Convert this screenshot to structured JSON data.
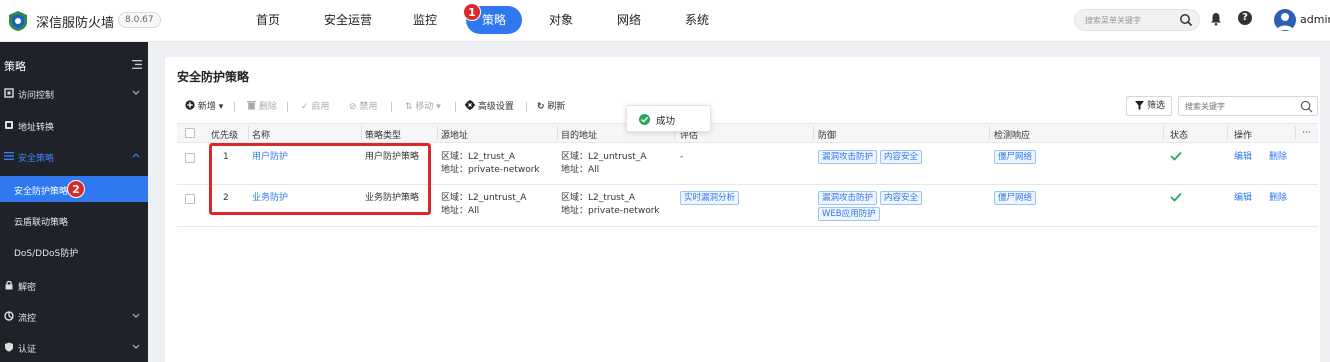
{
  "app": {
    "brand": "深信服防火墙",
    "version": "8.0.67",
    "user": "admin"
  },
  "topnav": [
    {
      "label": "首页"
    },
    {
      "label": "安全运营"
    },
    {
      "label": "监控"
    },
    {
      "label": "策略"
    },
    {
      "label": "对象"
    },
    {
      "label": "网络"
    },
    {
      "label": "系统"
    }
  ],
  "topnav_badge": "1",
  "top_search": {
    "placeholder": "搜索菜单关键字"
  },
  "sidebar": {
    "title": "策略",
    "items": [
      {
        "label": "访问控制",
        "icon": "access-control-icon"
      },
      {
        "label": "地址转换",
        "icon": "address-translation-icon"
      },
      {
        "label": "安全策略",
        "icon": "list-icon"
      },
      {
        "label": "解密",
        "icon": "lock-icon"
      },
      {
        "label": "流控",
        "icon": "flow-control-icon"
      },
      {
        "label": "认证",
        "icon": "shield-icon"
      }
    ],
    "sub_items": [
      {
        "label": "安全防护策略"
      },
      {
        "label": "云盾联动策略"
      },
      {
        "label": "DoS/DDoS防护"
      }
    ],
    "sub_badge": "2"
  },
  "panel": {
    "title": "安全防护策略",
    "toolbar": {
      "new": "新增",
      "delete": "删除",
      "enable": "启用",
      "disable": "禁用",
      "move": "移动",
      "advanced": "高级设置",
      "refresh": "刷新"
    },
    "filter": "筛选",
    "search_placeholder": "搜索关键字"
  },
  "table": {
    "headers": [
      "优先级",
      "名称",
      "策略类型",
      "源地址",
      "目的地址",
      "评估",
      "防御",
      "检测响应",
      "状态",
      "操作",
      "···"
    ],
    "rows": [
      {
        "priority": "1",
        "name": "用户防护",
        "type": "用户防护策略",
        "src_zone": "区域：L2_trust_A",
        "src_addr": "地址：private-network",
        "dst_zone": "区域：L2_untrust_A",
        "dst_addr": "地址：All",
        "eval": "-",
        "eval_tags": [],
        "defense_tags": [
          "漏洞攻击防护",
          "内容安全"
        ],
        "detect_tags": [
          "僵尸网络"
        ],
        "status": "enabled",
        "edit": "编辑",
        "delete": "删除"
      },
      {
        "priority": "2",
        "name": "业务防护",
        "type": "业务防护策略",
        "src_zone": "区域：L2_untrust_A",
        "src_addr": "地址：All",
        "dst_zone": "区域：L2_trust_A",
        "dst_addr": "地址：private-network",
        "eval": "",
        "eval_tags": [
          "实时漏洞分析"
        ],
        "defense_tags": [
          "漏洞攻击防护",
          "内容安全",
          "WEB应用防护"
        ],
        "detect_tags": [
          "僵尸网络"
        ],
        "status": "enabled",
        "edit": "编辑",
        "delete": "删除"
      }
    ]
  },
  "toast": {
    "text": "成功"
  },
  "colors": {
    "accent": "#2f78f0",
    "sidebar_bg": "#1f2329",
    "highlight": "#d9282a",
    "success": "#2aa65a"
  }
}
